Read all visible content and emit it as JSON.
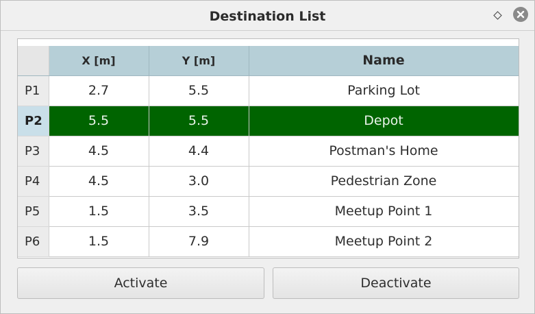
{
  "window": {
    "title": "Destination List"
  },
  "table": {
    "columns": [
      "X [m]",
      "Y [m]",
      "Name"
    ],
    "rows": [
      {
        "id": "P1",
        "x": "2.7",
        "y": "5.5",
        "name": "Parking Lot"
      },
      {
        "id": "P2",
        "x": "5.5",
        "y": "5.5",
        "name": "Depot"
      },
      {
        "id": "P3",
        "x": "4.5",
        "y": "4.4",
        "name": "Postman's Home"
      },
      {
        "id": "P4",
        "x": "4.5",
        "y": "3.0",
        "name": "Pedestrian Zone"
      },
      {
        "id": "P5",
        "x": "1.5",
        "y": "3.5",
        "name": "Meetup Point 1"
      },
      {
        "id": "P6",
        "x": "1.5",
        "y": "7.9",
        "name": "Meetup Point 2"
      }
    ],
    "selected_row": "P2"
  },
  "buttons": {
    "activate": "Activate",
    "deactivate": "Deactivate"
  },
  "icons": {
    "pin": "pin-icon",
    "close": "close-icon"
  },
  "colors": {
    "header_bg": "#b6cfd7",
    "selected_bg": "#006400"
  }
}
